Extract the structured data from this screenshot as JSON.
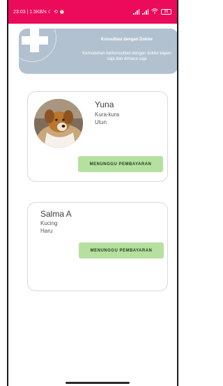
{
  "status_bar": {
    "time_speed": "23:03 | 1.5KB/s",
    "icons": [
      "moon-icon",
      "sync-icon",
      "alarm-icon"
    ],
    "battery": "95"
  },
  "banner": {
    "title": "Konsultasi dengan Dokter",
    "description": "Kemudahan berkonsultasi dengan dokter kapan saja dan dimana saja"
  },
  "consultations": [
    {
      "name": "Yuna",
      "type": "Kura-kura",
      "symptom": "Utun",
      "has_photo": true,
      "status": "MENUNGGU PEMBAYARAN"
    },
    {
      "name": "Salma A",
      "type": "Kucing",
      "symptom": "Haru",
      "has_photo": false,
      "status": "MENUNGGU PEMBAYARAN"
    }
  ],
  "colors": {
    "status_bar": "#ec0a5b",
    "banner": "#b2c1d0",
    "status_button": "#b6e0a0"
  }
}
